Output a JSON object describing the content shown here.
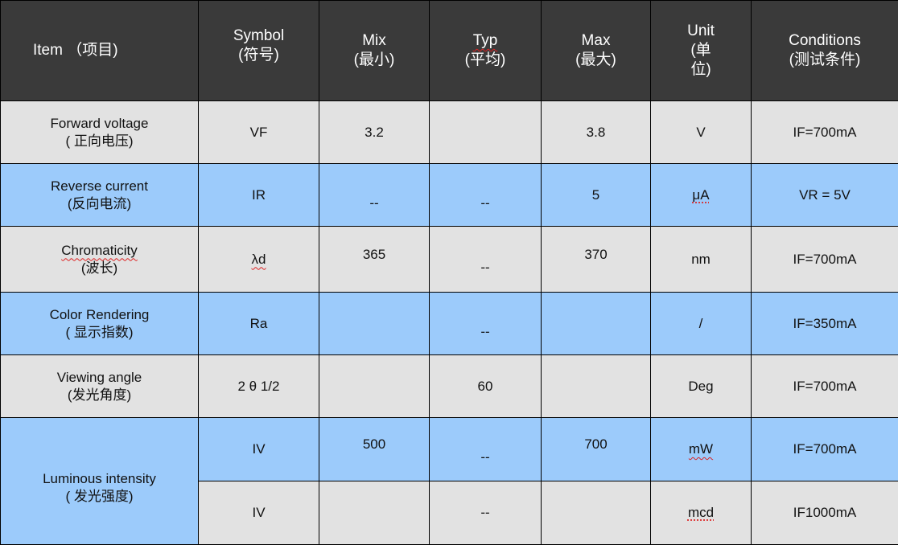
{
  "header": {
    "item": "Item （项目)",
    "symbol": [
      "Symbol",
      "(符号)"
    ],
    "min": [
      "Mix",
      "(最小)"
    ],
    "typ": [
      "Typ",
      "(平均)"
    ],
    "max": [
      "Max",
      "(最大)"
    ],
    "unit": [
      "Unit",
      "(单",
      "位)"
    ],
    "conditions": [
      "Conditions",
      "(测试条件)"
    ]
  },
  "rows": [
    {
      "item": [
        "Forward voltage",
        "( 正向电压)"
      ],
      "symbol": "VF",
      "min": "3.2",
      "typ": "",
      "max": "3.8",
      "unit": "V",
      "conditions": "IF=700mA"
    },
    {
      "item": [
        "Reverse current",
        "(反向电流)"
      ],
      "symbol": "IR",
      "min": "--",
      "typ": "--",
      "max": "5",
      "unit": "μA",
      "conditions": "VR = 5V"
    },
    {
      "item": [
        "Chromaticity",
        "(波长)"
      ],
      "symbol": "λd",
      "min": "365",
      "typ": "--",
      "max": "370",
      "unit": "nm",
      "conditions": "IF=700mA"
    },
    {
      "item": [
        "Color Rendering",
        "( 显示指数)"
      ],
      "symbol": "Ra",
      "min": "",
      "typ": "--",
      "max": "",
      "unit": "/",
      "conditions": "IF=350mA"
    },
    {
      "item": [
        "Viewing angle",
        "(发光角度)"
      ],
      "symbol": "2 θ 1/2",
      "min": "",
      "typ": "60",
      "max": "",
      "unit": "Deg",
      "conditions": "IF=700mA"
    },
    {
      "item": [
        "Luminous intensity",
        "( 发光强度)"
      ],
      "symbol": "IV",
      "min": "500",
      "typ": "--",
      "max": "700",
      "unit": "mW",
      "conditions": "IF=700mA"
    },
    {
      "symbol": "IV",
      "min": "",
      "typ": "--",
      "max": "",
      "unit": "mcd",
      "conditions": "IF1000mA"
    }
  ]
}
